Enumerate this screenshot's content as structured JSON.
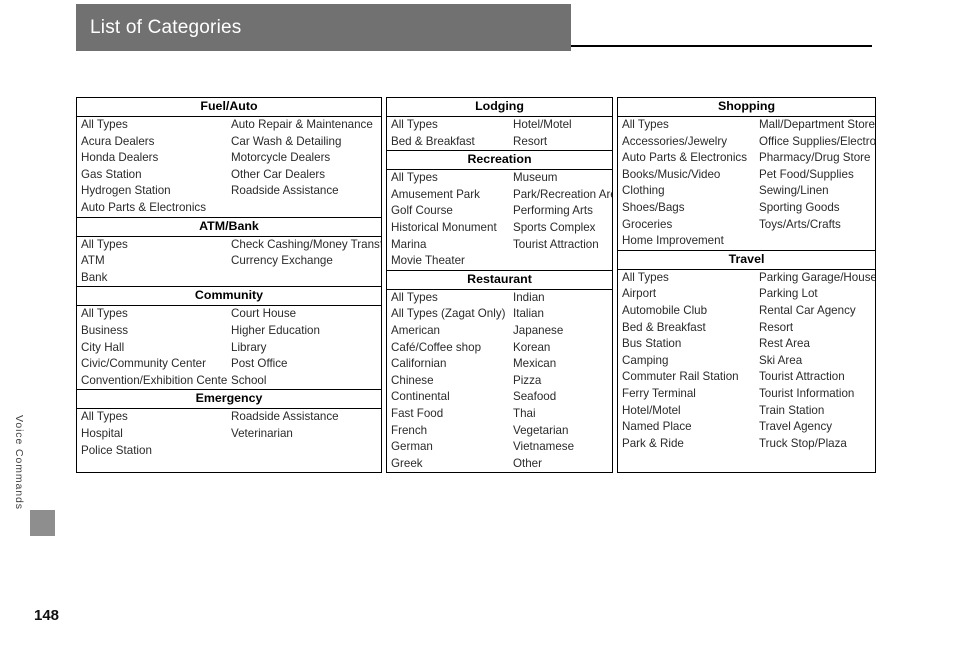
{
  "header": {
    "title": "List of Categories",
    "band_color": "#717171",
    "title_color": "#ffffff",
    "rule_color": "#000000"
  },
  "side_tab": {
    "label": "Voice Commands",
    "tab_color": "#8e8e8e"
  },
  "footer": {
    "page_number": "148"
  },
  "columns": [
    {
      "name": "column-left",
      "sections": [
        {
          "title": "Fuel/Auto",
          "rows": [
            [
              "All Types",
              "Auto Repair & Maintenance"
            ],
            [
              "Acura Dealers",
              "Car Wash & Detailing"
            ],
            [
              "Honda Dealers",
              "Motorcycle Dealers"
            ],
            [
              "Gas Station",
              "Other Car Dealers"
            ],
            [
              "Hydrogen Station",
              "Roadside Assistance"
            ],
            [
              "Auto Parts & Electronics",
              ""
            ]
          ]
        },
        {
          "title": "ATM/Bank",
          "rows": [
            [
              "All Types",
              "Check Cashing/Money Transfer"
            ],
            [
              "ATM",
              "Currency Exchange"
            ],
            [
              "Bank",
              ""
            ]
          ]
        },
        {
          "title": "Community",
          "rows": [
            [
              "All Types",
              "Court House"
            ],
            [
              "Business",
              "Higher Education"
            ],
            [
              "City Hall",
              "Library"
            ],
            [
              "Civic/Community Center",
              "Post Office"
            ],
            [
              "Convention/Exhibition Center",
              "School"
            ]
          ]
        },
        {
          "title": "Emergency",
          "rows": [
            [
              "All Types",
              "Roadside Assistance"
            ],
            [
              "Hospital",
              "Veterinarian"
            ],
            [
              "Police Station",
              ""
            ]
          ]
        }
      ]
    },
    {
      "name": "column-middle",
      "sections": [
        {
          "title": "Lodging",
          "rows": [
            [
              "All Types",
              "Hotel/Motel"
            ],
            [
              "Bed & Breakfast",
              "Resort"
            ]
          ]
        },
        {
          "title": "Recreation",
          "rows": [
            [
              "All Types",
              "Museum"
            ],
            [
              "Amusement Park",
              "Park/Recreation Area"
            ],
            [
              "Golf Course",
              "Performing Arts"
            ],
            [
              "Historical Monument",
              "Sports Complex"
            ],
            [
              "Marina",
              "Tourist Attraction"
            ],
            [
              "Movie Theater",
              ""
            ]
          ]
        },
        {
          "title": "Restaurant",
          "rows": [
            [
              "All Types",
              "Indian"
            ],
            [
              "All Types (Zagat Only)",
              "Italian"
            ],
            [
              "American",
              "Japanese"
            ],
            [
              "Café/Coffee shop",
              "Korean"
            ],
            [
              "Californian",
              "Mexican"
            ],
            [
              "Chinese",
              "Pizza"
            ],
            [
              "Continental",
              "Seafood"
            ],
            [
              "Fast Food",
              "Thai"
            ],
            [
              "French",
              "Vegetarian"
            ],
            [
              "German",
              "Vietnamese"
            ],
            [
              "Greek",
              "Other"
            ]
          ]
        }
      ]
    },
    {
      "name": "column-right",
      "sections": [
        {
          "title": "Shopping",
          "rows": [
            [
              "All Types",
              "Mall/Department Store"
            ],
            [
              "Accessories/Jewelry",
              "Office Supplies/Electronics"
            ],
            [
              "Auto Parts & Electronics",
              "Pharmacy/Drug Store"
            ],
            [
              "Books/Music/Video",
              "Pet Food/Supplies"
            ],
            [
              "Clothing",
              "Sewing/Linen"
            ],
            [
              "Shoes/Bags",
              "Sporting Goods"
            ],
            [
              "Groceries",
              "Toys/Arts/Crafts"
            ],
            [
              "Home Improvement",
              ""
            ]
          ]
        },
        {
          "title": "Travel",
          "rows": [
            [
              "All Types",
              "Parking Garage/House"
            ],
            [
              "Airport",
              "Parking Lot"
            ],
            [
              "Automobile Club",
              "Rental Car Agency"
            ],
            [
              "Bed & Breakfast",
              "Resort"
            ],
            [
              "Bus Station",
              "Rest Area"
            ],
            [
              "Camping",
              "Ski Area"
            ],
            [
              "Commuter Rail Station",
              "Tourist Attraction"
            ],
            [
              "Ferry Terminal",
              "Tourist Information"
            ],
            [
              "Hotel/Motel",
              "Train Station"
            ],
            [
              "Named Place",
              "Travel Agency"
            ],
            [
              "Park & Ride",
              "Truck Stop/Plaza"
            ]
          ]
        }
      ]
    }
  ]
}
